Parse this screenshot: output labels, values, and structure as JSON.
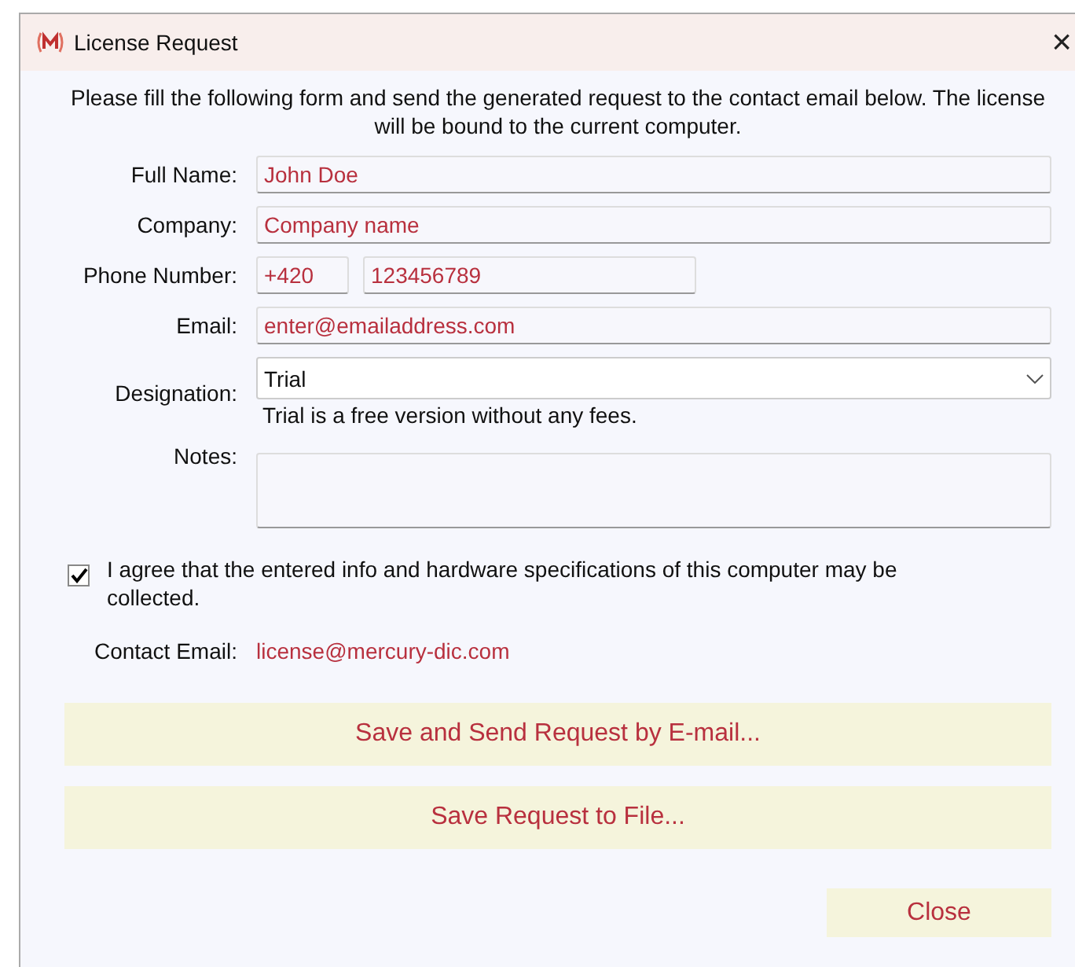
{
  "window": {
    "title": "License Request",
    "close": "×"
  },
  "intro": "Please fill the following form and send the generated request to the contact email below. The license will be bound to the current computer.",
  "fields": [
    {
      "kind": "text",
      "label": "Full Name:",
      "value": "John Doe"
    },
    {
      "kind": "text",
      "label": "Company:",
      "value": "Company name"
    },
    {
      "kind": "phone",
      "label": "Phone Number:",
      "prefix": "+420",
      "value": "123456789"
    },
    {
      "kind": "text",
      "label": "Email:",
      "value": "enter@emailaddress.com"
    },
    {
      "kind": "select",
      "label": "Designation:",
      "value": "Trial",
      "hint": "Trial is a free version without any fees."
    },
    {
      "kind": "notes",
      "label": "Notes:"
    }
  ],
  "agreement": {
    "checked": true,
    "text": "I agree that the entered info and hardware specifications of this computer may be collected."
  },
  "contact": {
    "label": "Contact Email:",
    "value": "license@mercury-dic.com"
  },
  "buttons": [
    "Save and Send Request by E-mail...",
    "Save Request to File..."
  ],
  "close_button": "Close"
}
